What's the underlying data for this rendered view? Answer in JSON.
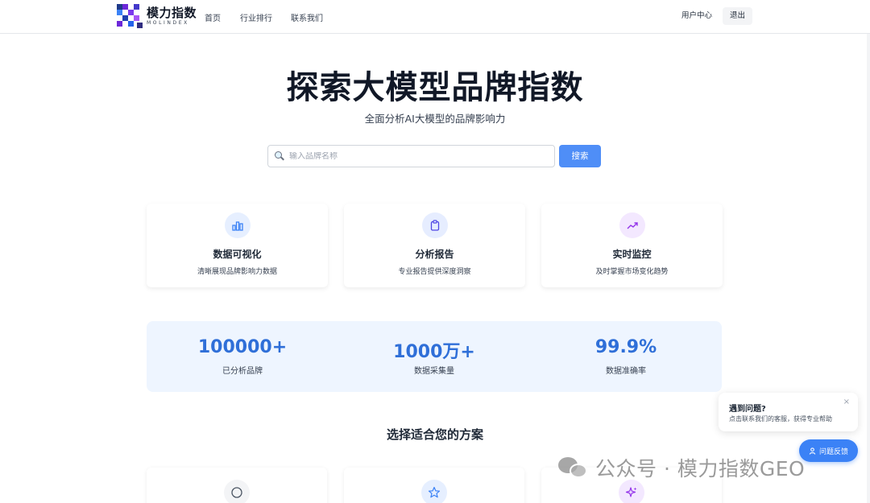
{
  "nav": {
    "logo_cn": "模力指数",
    "logo_en": "MOLINDEX",
    "links": [
      "首页",
      "行业排行",
      "联系我们"
    ],
    "user_center": "用户中心",
    "logout": "退出"
  },
  "hero": {
    "title": "探索大模型品牌指数",
    "subtitle": "全面分析AI大模型的品牌影响力",
    "search_placeholder": "输入品牌名称",
    "search_value": "",
    "search_button": "搜索"
  },
  "features": [
    {
      "icon": "bar-chart-icon",
      "title": "数据可视化",
      "desc": "清晰展现品牌影响力数据",
      "color": "#3b82f6",
      "bg": "#e6efff"
    },
    {
      "icon": "clipboard-icon",
      "title": "分析报告",
      "desc": "专业报告提供深度洞察",
      "color": "#4f46e5",
      "bg": "#e6edff"
    },
    {
      "icon": "trend-up-icon",
      "title": "实时监控",
      "desc": "及时掌握市场变化趋势",
      "color": "#9333ea",
      "bg": "#f3e8ff"
    }
  ],
  "stats": [
    {
      "value": "100000+",
      "label": "已分析品牌"
    },
    {
      "value": "1000万+",
      "label": "数据采集量"
    },
    {
      "value": "99.9%",
      "label": "数据准确率"
    }
  ],
  "plans": {
    "title": "选择适合您的方案",
    "icons": [
      "circle-icon",
      "star-icon",
      "sparkle-icon"
    ]
  },
  "help": {
    "title": "遇到问题?",
    "desc": "点击联系我们的客服，获得专业帮助",
    "close": "×",
    "button": "问题反馈"
  },
  "watermark": {
    "text": "公众号 · 模力指数GEO"
  },
  "colors": {
    "accent": "#4f8ef7",
    "stat_number": "#2f6fd8",
    "stats_bg": "#eef5ff"
  }
}
